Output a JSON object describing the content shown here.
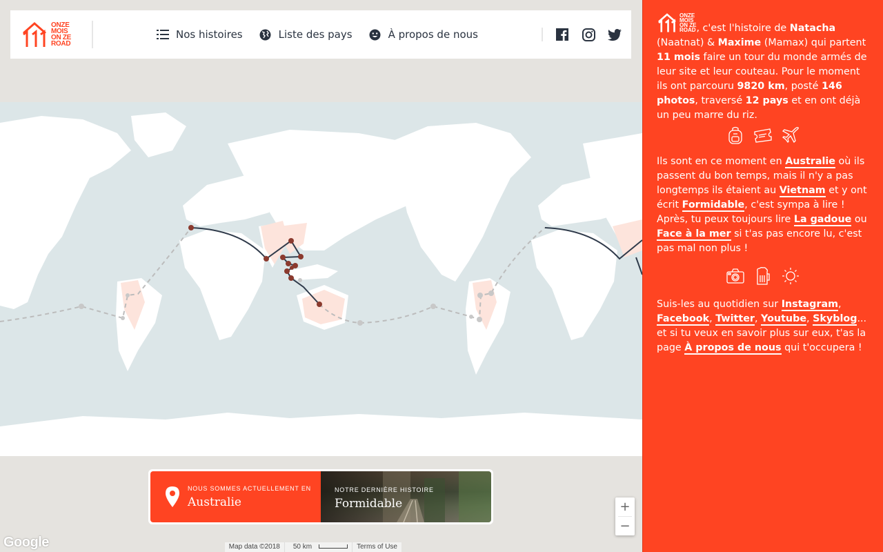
{
  "header": {
    "logo_lines": [
      "ONZE",
      "MOIS",
      "ON ZE",
      "ROAD"
    ],
    "nav": [
      {
        "label": "Nos histoires",
        "icon": "list-icon"
      },
      {
        "label": "Liste des pays",
        "icon": "globe-icon"
      },
      {
        "label": "À propos de nous",
        "icon": "smiley-icon"
      }
    ],
    "social": [
      "facebook-icon",
      "instagram-icon",
      "twitter-icon"
    ]
  },
  "banner": {
    "left_small": "Nous sommes actuellement en",
    "left_big": "Australie",
    "right_small": "Notre dernière histoire",
    "right_big": "Formidable"
  },
  "map": {
    "zoom_in": "+",
    "zoom_out": "−",
    "google": "Google",
    "attribution": [
      "Map data ©2018",
      "50 km",
      "Terms of Use"
    ]
  },
  "sidebar": {
    "intro": {
      "t1": ", c'est l'histoire de ",
      "name1": "Natacha",
      "t2": " (Naatnat) & ",
      "name2": "Maxime",
      "t3": " (Mamax) qui partent ",
      "months": "11 mois",
      "t4": " faire un tour du monde armés de leur site et leur couteau. Pour le moment ils ont parcouru ",
      "km": "9820 km",
      "t5": ", posté ",
      "photos": "146 photos",
      "t6": ", traversé ",
      "countries": "12 pays",
      "t7": " et en ont déjà un peu marre du riz."
    },
    "icons_row1": [
      "backpack-icon",
      "ticket-icon",
      "plane-icon"
    ],
    "current": {
      "t1": "Ils sont en ce moment en ",
      "l1": "Australie",
      "t2": " où ils passent du bon temps, mais il n'y a pas longtemps ils étaient au ",
      "l2": "Vietnam",
      "t3": " et y ont écrit ",
      "l3": "Formidable",
      "t4": ", c'est sympa à lire ! Après, tu peux toujours lire ",
      "l4": "La gadoue",
      "t5": " ou ",
      "l5": "Face à la mer",
      "t6": " si t'as pas encore lu, c'est pas mal non plus !"
    },
    "icons_row2": [
      "camera-icon",
      "beer-icon",
      "sun-icon"
    ],
    "follow": {
      "t1": "Suis-les au quotidien sur ",
      "l1": "Instagram",
      "s1": ", ",
      "l2": "Facebook",
      "s2": ", ",
      "l3": "Twitter",
      "s3": ", ",
      "l4": "Youtube",
      "s4": ", ",
      "l5": "Skyblog",
      "t2": "... et si tu veux en savoir plus sur eux, t'as la page ",
      "l6": "À propos de nous",
      "t3": " qui t'occupera !"
    }
  },
  "colors": {
    "accent": "#ff4422",
    "route": "#2f3a4a",
    "stop": "#8b3a2e",
    "land": "#ffffff",
    "ocean": "#dce6e8",
    "visited": "#fde4dc"
  }
}
